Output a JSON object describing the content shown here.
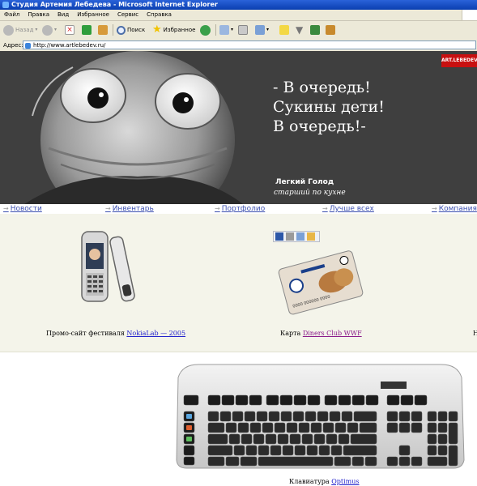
{
  "window": {
    "title": "Студия Артемия Лебедева - Microsoft Internet Explorer"
  },
  "menu": {
    "items": [
      "Файл",
      "Правка",
      "Вид",
      "Избранное",
      "Сервис",
      "Справка"
    ]
  },
  "toolbar": {
    "back_label": "Назад",
    "search_label": "Поиск",
    "favorites_label": "Избранное"
  },
  "address": {
    "label": "Адрес:",
    "url": "http://www.artlebedev.ru/"
  },
  "hero": {
    "quote": "- В очередь!\nСукины дети!\nВ очередь!-",
    "author": "Легкий Голод",
    "role": "старший по кухне"
  },
  "nav": {
    "items": [
      "Новости",
      "Инвентарь",
      "Портфолио",
      "Лучше всех",
      "Компания"
    ]
  },
  "products": [
    {
      "prefix": "Промо-сайт фестиваля ",
      "link": "NokiaLab — 2005"
    },
    {
      "prefix": "Карта ",
      "link": "Diners Club WWF"
    }
  ],
  "keyboard": {
    "prefix": "Клавиатура ",
    "link": "Optimus"
  }
}
